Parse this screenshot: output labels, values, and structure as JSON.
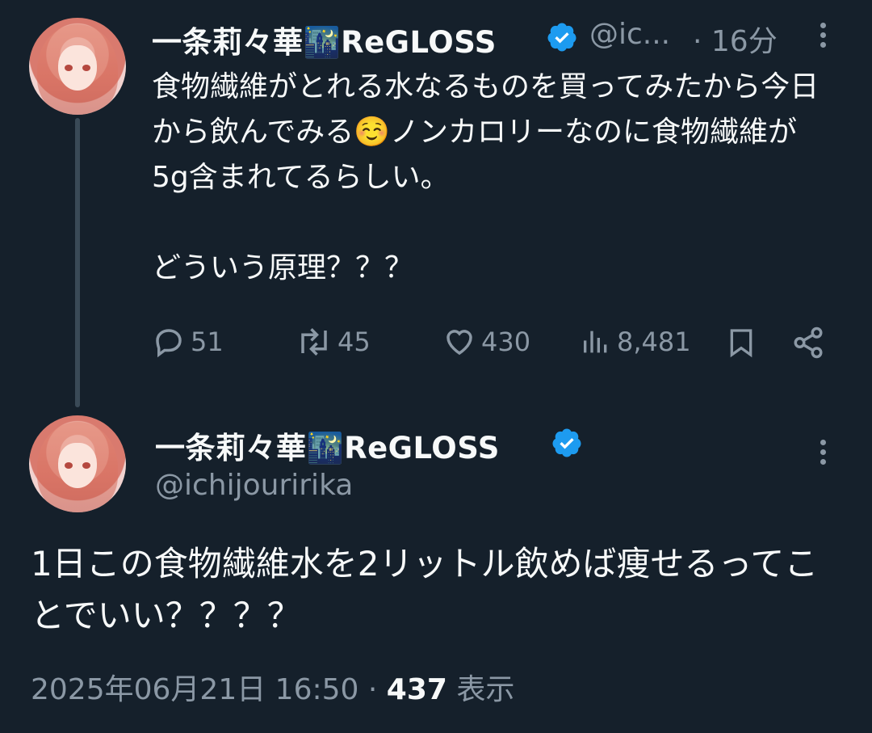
{
  "colors": {
    "background": "#15202b",
    "text": "#f7f9f9",
    "muted": "#8b98a5",
    "verified": "#1d9bf0"
  },
  "tweet1": {
    "display_name": "一条莉々華",
    "name_emoji": "🌃",
    "name_suffix": "ReGLOSS",
    "handle": "@ic...",
    "time": "· 16分",
    "text": "食物繊維がとれる水なるものを買ってみたから今日から飲んでみる☺️ノンカロリーなのに食物繊維が5g含まれてるらしい。\n\nどういう原理？？？",
    "replies": "51",
    "retweets": "45",
    "likes": "430",
    "views": "8,481",
    "icons": [
      "reply-icon",
      "retweet-icon",
      "like-icon",
      "views-icon",
      "bookmark-icon",
      "share-icon"
    ]
  },
  "tweet2": {
    "display_name": "一条莉々華",
    "name_emoji": "🌃",
    "name_suffix": "ReGLOSS",
    "handle": "@ichijouririka",
    "text": "1日この食物繊維水を2リットル飲めば痩せるってことでいい？？？？",
    "timestamp": "2025年06月21日 16:50",
    "separator": "·",
    "view_count": "437",
    "view_label": "表示"
  }
}
